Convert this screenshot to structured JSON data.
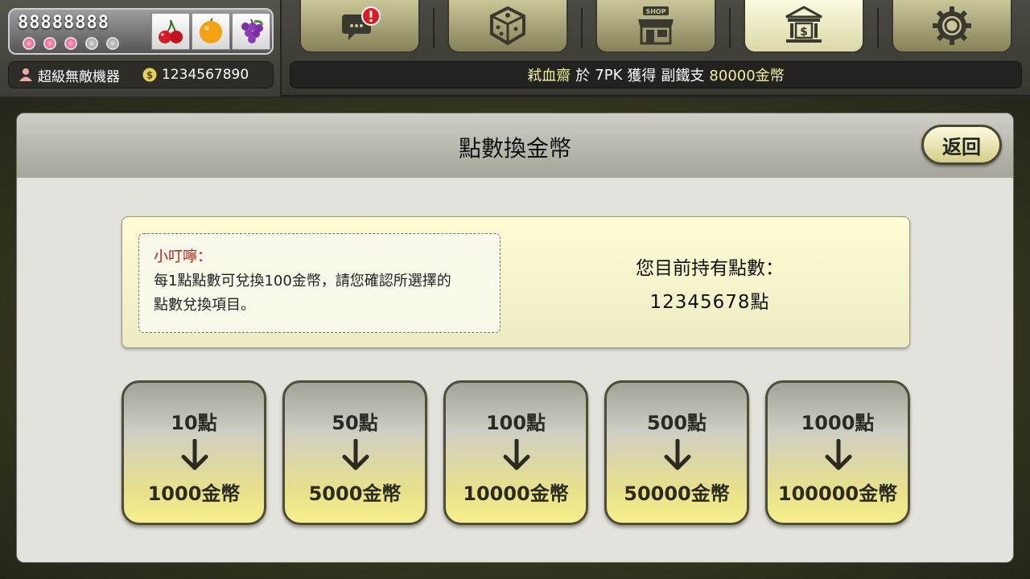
{
  "header": {
    "credits": "88888888",
    "lights": [
      "on",
      "on",
      "on",
      "off",
      "off"
    ],
    "fruits": [
      "cherry-icon",
      "orange-icon",
      "grape-icon"
    ],
    "username": "超級無敵機器",
    "coins": "1234567890"
  },
  "nav": [
    {
      "name": "chat-alert-icon",
      "active": false
    },
    {
      "name": "dice-icon",
      "active": false
    },
    {
      "name": "shop-icon",
      "active": false,
      "text": "SHOP"
    },
    {
      "name": "bank-icon",
      "active": true
    },
    {
      "name": "settings-gear-icon",
      "active": false
    }
  ],
  "ticker": {
    "player": "弒血齋",
    "at": "於",
    "game": "7PK",
    "got": "獲得",
    "hand": "副鐵支",
    "prize": "80000金幣"
  },
  "panel": {
    "title": "點數換金幣",
    "back": "返回"
  },
  "notice": {
    "title": "小叮嚀：",
    "line1": "每1點點數可兌換100金幣，請您確認所選擇的",
    "line2": "點數兌換項目。"
  },
  "points": {
    "label": "您目前持有點數：",
    "value": "12345678點"
  },
  "exchange_options": [
    {
      "points": "10點",
      "coins": "1000金幣"
    },
    {
      "points": "50點",
      "coins": "5000金幣"
    },
    {
      "points": "100點",
      "coins": "10000金幣"
    },
    {
      "points": "500點",
      "coins": "50000金幣"
    },
    {
      "points": "1000點",
      "coins": "100000金幣"
    }
  ],
  "colors": {
    "accent_yellow": "#f1f0a5",
    "notice_red": "#c0171c",
    "panel_bg": "#e3e2dc"
  }
}
